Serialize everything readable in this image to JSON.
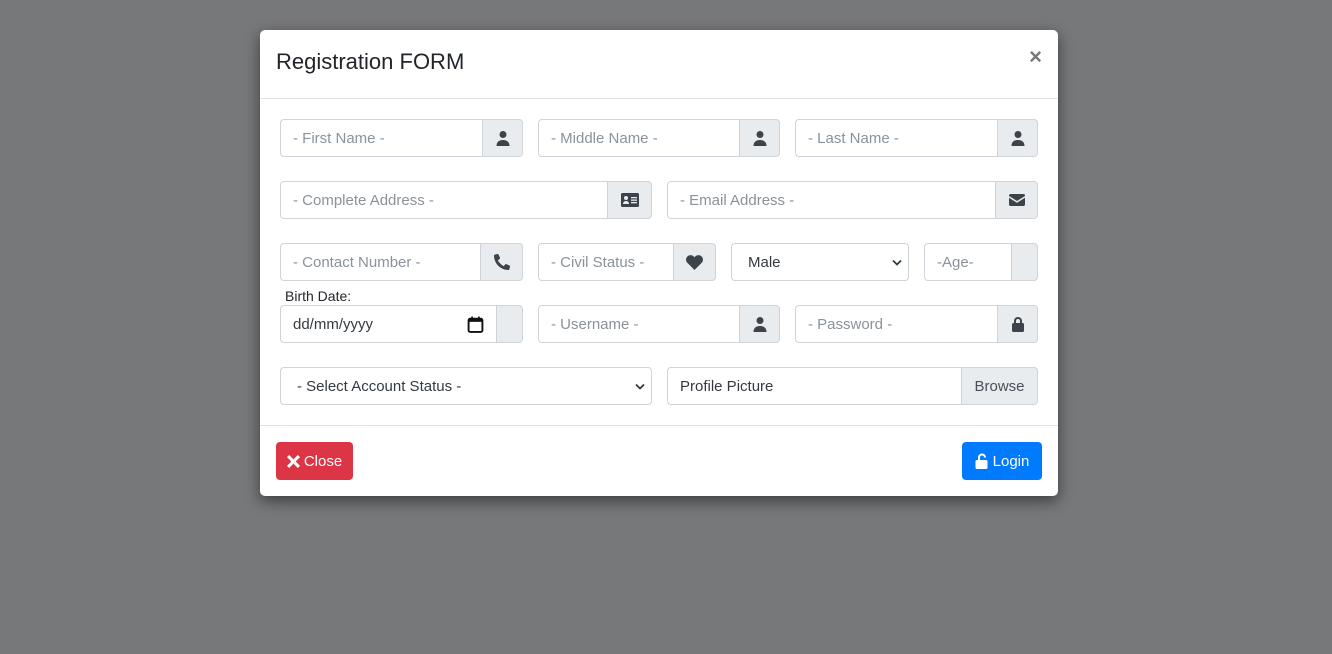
{
  "modal": {
    "title": "Registration FORM",
    "close_icon": "close-icon",
    "close_glyph": "×"
  },
  "fields": {
    "first_name": {
      "placeholder": "- First Name -",
      "icon": "user-icon"
    },
    "middle_name": {
      "placeholder": "- Middle Name -",
      "icon": "user-icon"
    },
    "last_name": {
      "placeholder": "- Last Name -",
      "icon": "user-icon"
    },
    "address": {
      "placeholder": "- Complete Address -",
      "icon": "address-card-icon"
    },
    "email": {
      "placeholder": "- Email Address -",
      "icon": "envelope-icon"
    },
    "contact": {
      "placeholder": "- Contact Number -",
      "icon": "phone-icon"
    },
    "civil_status": {
      "placeholder": "- Civil Status -",
      "icon": "heart-icon"
    },
    "gender": {
      "value": "Male"
    },
    "age": {
      "placeholder": "-Age-"
    },
    "birth_date": {
      "label": "Birth Date:",
      "placeholder": "dd/mm/yyyy",
      "icon": "calendar-icon"
    },
    "username": {
      "placeholder": "- Username -",
      "icon": "user-icon"
    },
    "password": {
      "placeholder": "- Password -",
      "icon": "lock-icon"
    },
    "account_status": {
      "value": "- Select Account Status -"
    },
    "profile_picture": {
      "label": "Profile Picture",
      "browse": "Browse"
    }
  },
  "footer": {
    "close_label": "Close",
    "close_color": "#dc3545",
    "login_label": "Login",
    "login_color": "#007bff"
  }
}
